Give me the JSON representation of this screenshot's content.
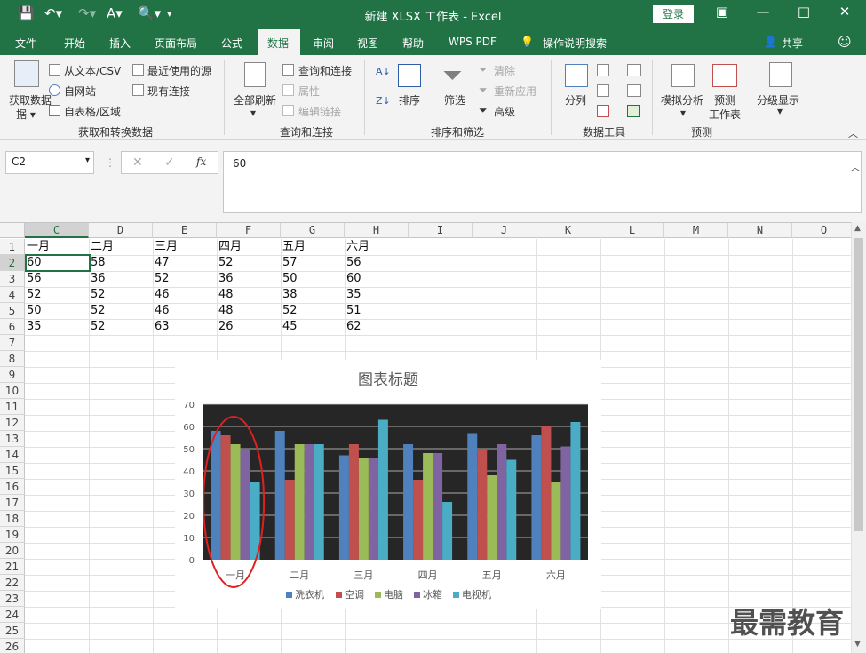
{
  "titlebar": {
    "title": "新建 XLSX 工作表 - Excel",
    "login_label": "登录",
    "minimize": "—",
    "restore": "□",
    "close": "✕",
    "ribbon_opts": "▣"
  },
  "menubar": {
    "items": [
      "文件",
      "开始",
      "插入",
      "页面布局",
      "公式",
      "数据",
      "审阅",
      "视图",
      "帮助",
      "WPS PDF",
      "操作说明搜索"
    ],
    "active": "数据",
    "share": "共享"
  },
  "ribbon": {
    "get_data": "获取数据",
    "from_text": "从文本/CSV",
    "from_web": "自网站",
    "from_table": "自表格/区域",
    "recent_sources": "最近使用的源",
    "existing_conn": "现有连接",
    "group1": "获取和转换数据",
    "refresh_all": "全部刷新",
    "queries_conn": "查询和连接",
    "properties": "属性",
    "edit_links": "编辑链接",
    "group2": "查询和连接",
    "sort": "排序",
    "filter": "筛选",
    "clear": "清除",
    "reapply": "重新应用",
    "advanced": "高级",
    "group3": "排序和筛选",
    "split": "分列",
    "group4": "数据工具",
    "whatif": "模拟分析",
    "forecast": "预测",
    "forecast_sheet": "工作表",
    "group5": "预测",
    "outline": "分级显示"
  },
  "formulabar": {
    "name_box": "C2",
    "formula": "60"
  },
  "grid": {
    "columns": [
      "C",
      "D",
      "E",
      "F",
      "G",
      "H",
      "I",
      "J",
      "K",
      "L",
      "M",
      "N",
      "O"
    ],
    "rows": [
      "1",
      "2",
      "3",
      "4",
      "5",
      "6",
      "7",
      "8",
      "9",
      "10",
      "11",
      "12",
      "13",
      "14",
      "15",
      "16",
      "17",
      "18",
      "19",
      "20",
      "21",
      "22",
      "23",
      "24",
      "25",
      "26"
    ],
    "header_row": [
      "一月",
      "二月",
      "三月",
      "四月",
      "五月",
      "六月"
    ],
    "data": [
      [
        "60",
        "58",
        "47",
        "52",
        "57",
        "56"
      ],
      [
        "56",
        "36",
        "52",
        "36",
        "50",
        "60"
      ],
      [
        "52",
        "52",
        "46",
        "48",
        "38",
        "35"
      ],
      [
        "50",
        "52",
        "46",
        "48",
        "52",
        "51"
      ],
      [
        "35",
        "52",
        "63",
        "26",
        "45",
        "62"
      ]
    ]
  },
  "chart_data": {
    "type": "bar",
    "title": "图表标题",
    "categories": [
      "一月",
      "二月",
      "三月",
      "四月",
      "五月",
      "六月"
    ],
    "series": [
      {
        "name": "洗衣机",
        "color": "#4f81bd",
        "values": [
          58,
          58,
          47,
          52,
          57,
          56
        ]
      },
      {
        "name": "空调",
        "color": "#c0504d",
        "values": [
          56,
          36,
          52,
          36,
          50,
          60
        ]
      },
      {
        "name": "电脑",
        "color": "#9bbb59",
        "values": [
          52,
          52,
          46,
          48,
          38,
          35
        ]
      },
      {
        "name": "冰箱",
        "color": "#8064a2",
        "values": [
          50,
          52,
          46,
          48,
          52,
          51
        ]
      },
      {
        "name": "电视机",
        "color": "#4bacc6",
        "values": [
          35,
          52,
          63,
          26,
          45,
          62
        ]
      }
    ],
    "yticks": [
      "0",
      "10",
      "20",
      "30",
      "40",
      "50",
      "60",
      "70"
    ],
    "ylim": [
      0,
      70
    ],
    "grid": true,
    "legend": "bottom",
    "plot_background": "#262626",
    "highlight": "一月"
  },
  "watermark": "最需教育"
}
